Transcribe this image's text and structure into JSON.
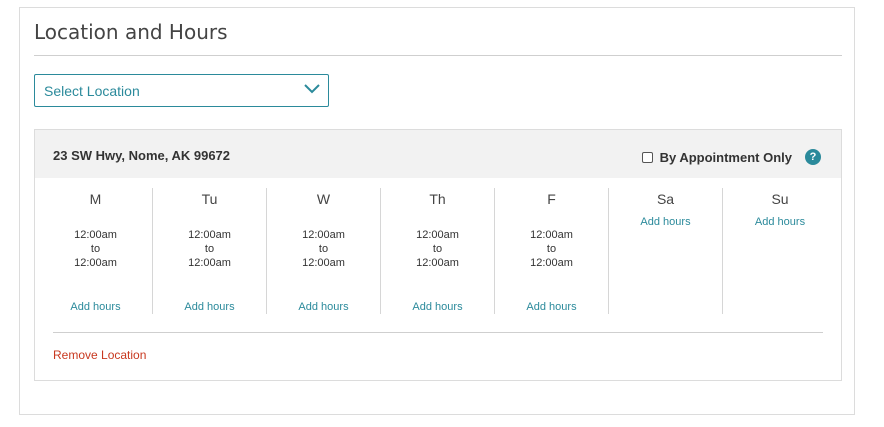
{
  "section": {
    "title": "Location and Hours"
  },
  "location_select": {
    "placeholder": "Select Location"
  },
  "location": {
    "address": "23 SW Hwy, Nome, AK 99672",
    "by_appointment_label": "By Appointment Only",
    "by_appointment_checked": false,
    "help_glyph": "?",
    "remove_label": "Remove Location",
    "days": [
      {
        "name": "M",
        "open": "12:00am",
        "sep": "to",
        "close": "12:00am",
        "add_label": "Add hours"
      },
      {
        "name": "Tu",
        "open": "12:00am",
        "sep": "to",
        "close": "12:00am",
        "add_label": "Add hours"
      },
      {
        "name": "W",
        "open": "12:00am",
        "sep": "to",
        "close": "12:00am",
        "add_label": "Add hours"
      },
      {
        "name": "Th",
        "open": "12:00am",
        "sep": "to",
        "close": "12:00am",
        "add_label": "Add hours"
      },
      {
        "name": "F",
        "open": "12:00am",
        "sep": "to",
        "close": "12:00am",
        "add_label": "Add hours"
      },
      {
        "name": "Sa",
        "add_label": "Add hours"
      },
      {
        "name": "Su",
        "add_label": "Add hours"
      }
    ]
  },
  "colors": {
    "accent": "#2b8a9b",
    "danger": "#c8381f",
    "header_bg": "#f2f2f2"
  },
  "icons": {
    "dropdown": "chevron-down-icon",
    "help": "help-circle-icon"
  }
}
